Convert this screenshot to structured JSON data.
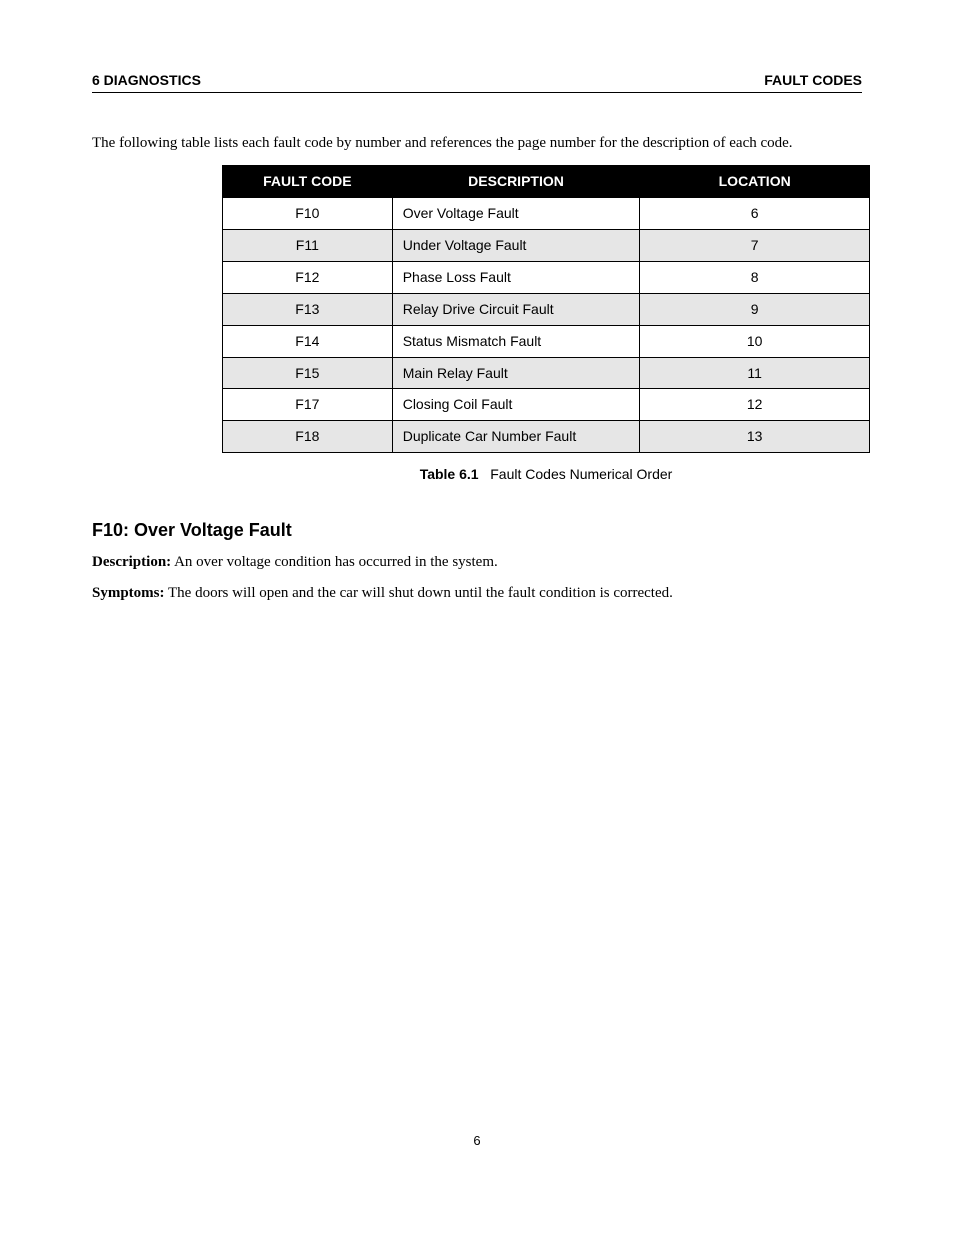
{
  "header": {
    "left": "6 DIAGNOSTICS",
    "right": "FAULT CODES"
  },
  "intro": "The following table lists each fault code by number and references the page number for the description of each code.",
  "table": {
    "columns": [
      "FAULT CODE",
      "DESCRIPTION",
      "LOCATION"
    ],
    "rows": [
      {
        "code": "F10",
        "desc": "Over Voltage Fault",
        "loc": "6"
      },
      {
        "code": "F11",
        "desc": "Under Voltage Fault",
        "loc": "7"
      },
      {
        "code": "F12",
        "desc": "Phase Loss Fault",
        "loc": "8"
      },
      {
        "code": "F13",
        "desc": "Relay Drive Circuit Fault",
        "loc": "9"
      },
      {
        "code": "F14",
        "desc": "Status Mismatch Fault",
        "loc": "10"
      },
      {
        "code": "F15",
        "desc": "Main Relay Fault",
        "loc": "11"
      },
      {
        "code": "F17",
        "desc": "Closing Coil Fault",
        "loc": "12"
      },
      {
        "code": "F18",
        "desc": "Duplicate Car Number Fault",
        "loc": "13"
      }
    ]
  },
  "caption": {
    "label": "Table 6.1",
    "text": "Fault Codes Numerical Order"
  },
  "section": {
    "heading": "F10: Over Voltage Fault",
    "desc_label": "Description:",
    "desc_text": " An over voltage condition has occurred in the system.",
    "symp_label": "Symptoms:",
    "symp_text": " The doors will open and the car will shut down until the fault condition is corrected."
  },
  "footer": {
    "pagenum": "6"
  }
}
